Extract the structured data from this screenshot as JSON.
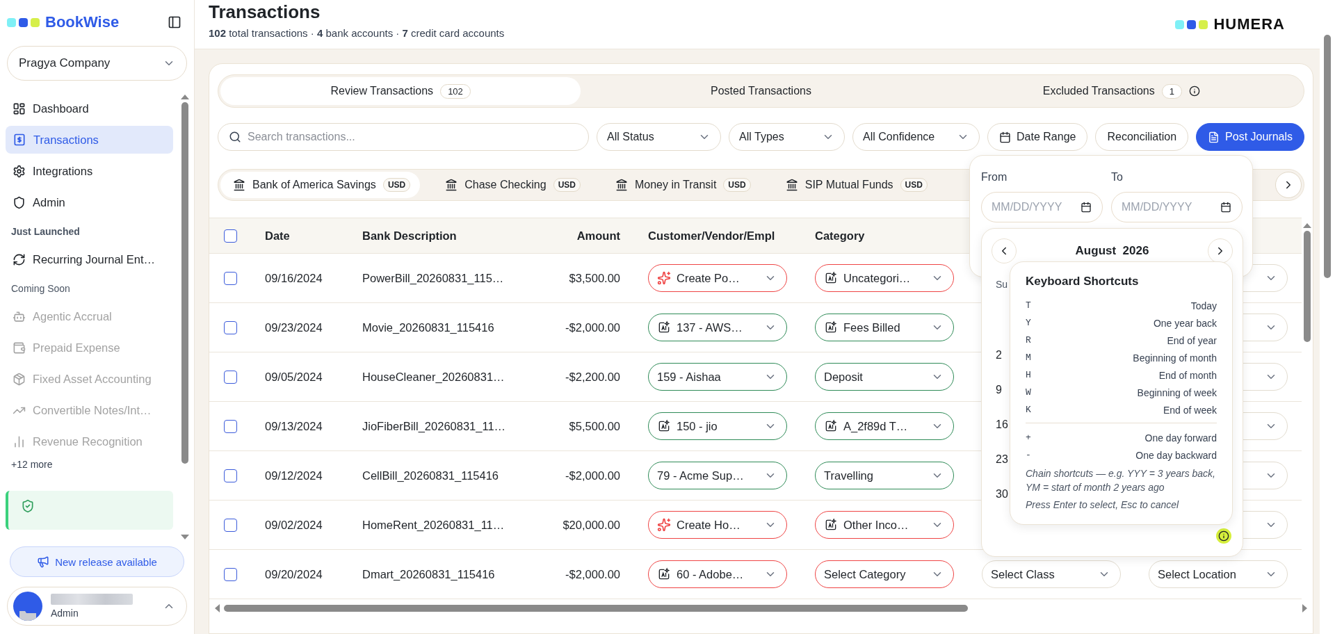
{
  "sidebar": {
    "brand": "BookWise",
    "company": "Pragya Company",
    "nav": [
      {
        "label": "Dashboard",
        "selected": false
      },
      {
        "label": "Transactions",
        "selected": true
      },
      {
        "label": "Integrations",
        "selected": false
      },
      {
        "label": "Admin",
        "selected": false
      }
    ],
    "sections": [
      {
        "title": "Just Launched",
        "kind": "launched",
        "items": [
          {
            "label": "Recurring Journal Ent…",
            "disabled": false
          }
        ]
      },
      {
        "title": "Coming Soon",
        "kind": "soon",
        "items": [
          {
            "label": "Agentic Accrual",
            "disabled": true
          },
          {
            "label": "Prepaid Expense",
            "disabled": true
          },
          {
            "label": "Fixed Asset Accounting",
            "disabled": true
          },
          {
            "label": "Convertible Notes/Int…",
            "disabled": true
          },
          {
            "label": "Revenue Recognition",
            "disabled": true
          }
        ]
      }
    ],
    "more": "+12 more",
    "release_button": "New release available",
    "user": {
      "role": "Admin"
    }
  },
  "header": {
    "title": "Transactions",
    "summary": "**102** total transactions · **4** bank accounts · **7** credit card accounts",
    "logo": "HUMERA"
  },
  "tabs": [
    {
      "label": "Review Transactions",
      "count": "102",
      "selected": true
    },
    {
      "label": "Posted Transactions",
      "selected": false
    },
    {
      "label": "Excluded Transactions",
      "count": "1",
      "info": true,
      "selected": false
    }
  ],
  "filters": {
    "search_placeholder": "Search transactions...",
    "dropdowns": [
      "All Status",
      "All Types",
      "All Confidence"
    ],
    "date_button": "Date Range",
    "reconciliation_button": "Reconciliation",
    "post_button": "Post Journals"
  },
  "accounts": [
    {
      "name": "Bank of America Savings",
      "currency": "USD",
      "selected": true
    },
    {
      "name": "Chase Checking",
      "currency": "USD",
      "selected": false
    },
    {
      "name": "Money in Transit",
      "currency": "USD",
      "selected": false
    },
    {
      "name": "SIP Mutual Funds",
      "currency": "USD",
      "selected": false
    }
  ],
  "table": {
    "select_all_checked": false,
    "columns": [
      "Date",
      "Bank Description",
      "Amount",
      "Customer/Vendor/Empl",
      "Category"
    ],
    "rows": [
      {
        "checked": false,
        "date": "09/16/2024",
        "description": "PowerBill_20260831_115…",
        "amount": "$3,500.00",
        "customer": {
          "text": "Create Po…",
          "kind": "create",
          "color": "#ef4444"
        },
        "category": {
          "text": "Uncategori…",
          "kind": "ai",
          "color": "#ef4444"
        }
      },
      {
        "checked": false,
        "date": "09/23/2024",
        "description": "Movie_20260831_115416",
        "amount": "-$2,000.00",
        "customer": {
          "text": "137 - AWS…",
          "kind": "ai",
          "color": "#2e8b57"
        },
        "category": {
          "text": "Fees Billed",
          "kind": "ai",
          "color": "#2e8b57"
        }
      },
      {
        "checked": false,
        "date": "09/05/2024",
        "description": "HouseCleaner_20260831…",
        "amount": "-$2,200.00",
        "customer": {
          "text": "159 - Aishaa",
          "kind": "plain",
          "color": "#2e8b57"
        },
        "category": {
          "text": "Deposit",
          "kind": "plain",
          "color": "#2e8b57"
        }
      },
      {
        "checked": false,
        "date": "09/13/2024",
        "description": "JioFiberBill_20260831_11…",
        "amount": "$5,500.00",
        "customer": {
          "text": "150 - jio",
          "kind": "ai",
          "color": "#2e8b57"
        },
        "category": {
          "text": "A_2f89d T…",
          "kind": "ai",
          "color": "#2e8b57"
        }
      },
      {
        "checked": false,
        "date": "09/12/2024",
        "description": "CellBill_20260831_115416",
        "amount": "-$2,000.00",
        "customer": {
          "text": "79 - Acme Sup…",
          "kind": "plain",
          "color": "#2e8b57"
        },
        "category": {
          "text": "Travelling",
          "kind": "plain",
          "color": "#2e8b57"
        }
      },
      {
        "checked": false,
        "date": "09/02/2024",
        "description": "HomeRent_20260831_11…",
        "amount": "$20,000.00",
        "customer": {
          "text": "Create Ho…",
          "kind": "create",
          "color": "#ef4444"
        },
        "category": {
          "text": "Other Inco…",
          "kind": "ai",
          "color": "#ef4444"
        }
      },
      {
        "checked": false,
        "date": "09/20/2024",
        "description": "Dmart_20260831_115416",
        "amount": "-$2,000.00",
        "customer": {
          "text": "60 - Adobe…",
          "kind": "ai",
          "color": "#ef4444"
        },
        "category": {
          "text": "Select Category",
          "kind": "plain",
          "color": "#ef4444"
        },
        "class": "Select Class",
        "location": "Select Location"
      }
    ]
  },
  "date_popup": {
    "from_label": "From",
    "to_label": "To",
    "from_placeholder": "MM/DD/YYYY",
    "to_placeholder": "MM/DD/YYYY"
  },
  "calendar": {
    "month": "August  2026",
    "weekday": "Su",
    "sundays": [
      "2",
      "9",
      "16",
      "23",
      "30"
    ]
  },
  "shortcuts": {
    "title": "Keyboard Shortcuts",
    "groups": [
      [
        {
          "key": "T",
          "label": "Today"
        },
        {
          "key": "Y",
          "label": "One year back"
        },
        {
          "key": "R",
          "label": "End of year"
        },
        {
          "key": "M",
          "label": "Beginning of month"
        },
        {
          "key": "H",
          "label": "End of month"
        },
        {
          "key": "W",
          "label": "Beginning of week"
        },
        {
          "key": "K",
          "label": "End of week"
        }
      ],
      [
        {
          "key": "+",
          "label": "One day forward"
        },
        {
          "key": "-",
          "label": "One day backward"
        }
      ]
    ],
    "notes": [
      "Chain shortcuts — e.g. YYY = 3 years back, YM = start of month 2 years ago",
      "Press Enter to select, Esc to cancel"
    ]
  }
}
